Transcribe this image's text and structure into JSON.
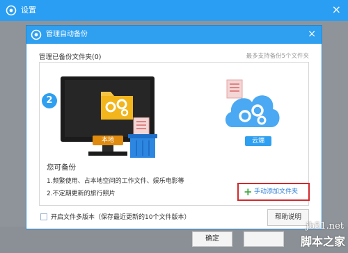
{
  "outer_window": {
    "title": "设置",
    "close_glyph": "×",
    "ok_label": "确定",
    "title_icon": "gear-icon"
  },
  "dialog": {
    "title": "管理自动备份",
    "close_glyph": "×",
    "title_icon": "gear-icon",
    "section_label": "管理已备份文件夹(0)",
    "section_hint": "最多支持备份5个文件夹",
    "step_number": "2",
    "local_label": "本地",
    "cloud_label": "云端",
    "can_backup_title": "您可备份",
    "items": [
      "1.频繁使用、占本地空间的工作文件、娱乐电影等",
      "2.不定期更新的旅行照片"
    ],
    "add_folder_plus": "+",
    "add_folder_label": "手动添加文件夹",
    "version_checkbox_label": "开启文件多版本（保存最近更新的10个文件版本）",
    "version_checkbox_checked": false,
    "help_label": "帮助说明"
  },
  "watermark": {
    "line1": "jb51.net",
    "line2": "脚本之家"
  },
  "colors": {
    "titlebar_blue": "#2f9ff0",
    "accent_orange": "#e08a0e",
    "highlight_red": "#d3282b",
    "add_link_blue": "#2f7fd6",
    "plus_green": "#3aa83a"
  }
}
